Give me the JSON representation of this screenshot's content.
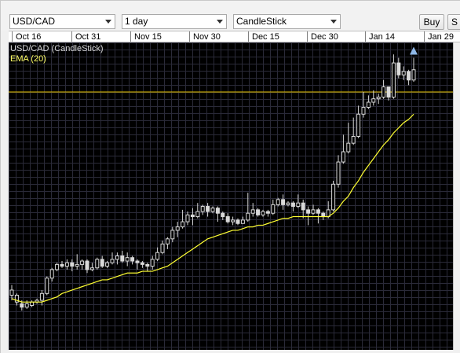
{
  "toolbar": {
    "symbol": "USD/CAD",
    "interval": "1 day",
    "chart_type": "CandleStick",
    "buy_label": "Buy",
    "sell_label": "S"
  },
  "date_axis": [
    "Oct 16",
    "Oct 31",
    "Nov 15",
    "Nov 30",
    "Dec 15",
    "Dec 30",
    "Jan 14",
    "Jan 29"
  ],
  "legend": {
    "main": "USD/CAD (CandleStick)",
    "ema": "EMA (20)"
  },
  "colors": {
    "background": "#000000",
    "grid": "#2a2a38",
    "candle": "#d9d9d9",
    "ema": "#ffff33",
    "price_line": "#e6c200",
    "arrow": "#8fb8e8"
  },
  "chart_data": {
    "type": "candlestick",
    "ylim": [
      0.965,
      1.145
    ],
    "price_line": 1.116,
    "candles": [
      [
        0.997,
        1.0,
        0.994,
        1.003
      ],
      [
        0.993,
        0.997,
        0.991,
        0.998
      ],
      [
        0.992,
        0.99,
        0.988,
        0.994
      ],
      [
        0.99,
        0.992,
        0.989,
        0.994
      ],
      [
        0.991,
        0.993,
        0.99,
        0.994
      ],
      [
        0.993,
        0.994,
        0.992,
        0.995
      ],
      [
        0.994,
        0.998,
        0.991,
        1.0
      ],
      [
        0.998,
        1.007,
        0.997,
        1.008
      ],
      [
        1.007,
        1.012,
        1.005,
        1.013
      ],
      [
        1.012,
        1.015,
        1.011,
        1.016
      ],
      [
        1.015,
        1.014,
        1.013,
        1.017
      ],
      [
        1.014,
        1.016,
        1.012,
        1.018
      ],
      [
        1.016,
        1.014,
        1.011,
        1.018
      ],
      [
        1.014,
        1.015,
        1.012,
        1.021
      ],
      [
        1.015,
        1.017,
        1.012,
        1.018
      ],
      [
        1.017,
        1.012,
        1.01,
        1.018
      ],
      [
        1.012,
        1.013,
        1.011,
        1.016
      ],
      [
        1.013,
        1.018,
        1.012,
        1.019
      ],
      [
        1.018,
        1.014,
        1.013,
        1.02
      ],
      [
        1.014,
        1.016,
        1.013,
        1.017
      ],
      [
        1.016,
        1.018,
        1.015,
        1.022
      ],
      [
        1.018,
        1.02,
        1.015,
        1.022
      ],
      [
        1.02,
        1.017,
        1.016,
        1.023
      ],
      [
        1.017,
        1.019,
        1.014,
        1.022
      ],
      [
        1.019,
        1.017,
        1.015,
        1.02
      ],
      [
        1.017,
        1.016,
        1.012,
        1.018
      ],
      [
        1.016,
        1.015,
        1.013,
        1.017
      ],
      [
        1.015,
        1.014,
        1.011,
        1.016
      ],
      [
        1.014,
        1.018,
        1.012,
        1.02
      ],
      [
        1.018,
        1.022,
        1.017,
        1.025
      ],
      [
        1.022,
        1.027,
        1.021,
        1.029
      ],
      [
        1.027,
        1.03,
        1.024,
        1.031
      ],
      [
        1.03,
        1.035,
        1.028,
        1.037
      ],
      [
        1.035,
        1.037,
        1.031,
        1.04
      ],
      [
        1.037,
        1.04,
        1.036,
        1.047
      ],
      [
        1.04,
        1.044,
        1.038,
        1.046
      ],
      [
        1.044,
        1.043,
        1.038,
        1.048
      ],
      [
        1.043,
        1.046,
        1.042,
        1.051
      ],
      [
        1.046,
        1.049,
        1.044,
        1.05
      ],
      [
        1.049,
        1.046,
        1.043,
        1.051
      ],
      [
        1.046,
        1.048,
        1.045,
        1.049
      ],
      [
        1.048,
        1.045,
        1.04,
        1.049
      ],
      [
        1.045,
        1.043,
        1.041,
        1.046
      ],
      [
        1.043,
        1.04,
        1.039,
        1.045
      ],
      [
        1.04,
        1.041,
        1.038,
        1.043
      ],
      [
        1.041,
        1.039,
        1.038,
        1.042
      ],
      [
        1.039,
        1.041,
        1.039,
        1.043
      ],
      [
        1.041,
        1.045,
        1.04,
        1.057
      ],
      [
        1.045,
        1.047,
        1.043,
        1.051
      ],
      [
        1.047,
        1.044,
        1.043,
        1.048
      ],
      [
        1.044,
        1.046,
        1.043,
        1.047
      ],
      [
        1.046,
        1.045,
        1.043,
        1.047
      ],
      [
        1.045,
        1.05,
        1.044,
        1.053
      ],
      [
        1.05,
        1.053,
        1.049,
        1.054
      ],
      [
        1.053,
        1.05,
        1.047,
        1.056
      ],
      [
        1.05,
        1.051,
        1.049,
        1.052
      ],
      [
        1.051,
        1.049,
        1.046,
        1.052
      ],
      [
        1.049,
        1.051,
        1.048,
        1.056
      ],
      [
        1.051,
        1.047,
        1.042,
        1.053
      ],
      [
        1.047,
        1.045,
        1.038,
        1.049
      ],
      [
        1.045,
        1.047,
        1.044,
        1.05
      ],
      [
        1.047,
        1.045,
        1.039,
        1.048
      ],
      [
        1.045,
        1.043,
        1.041,
        1.046
      ],
      [
        1.043,
        1.047,
        1.042,
        1.052
      ],
      [
        1.047,
        1.062,
        1.046,
        1.064
      ],
      [
        1.062,
        1.075,
        1.06,
        1.079
      ],
      [
        1.075,
        1.081,
        1.074,
        1.091
      ],
      [
        1.081,
        1.086,
        1.08,
        1.098
      ],
      [
        1.086,
        1.09,
        1.085,
        1.101
      ],
      [
        1.09,
        1.103,
        1.089,
        1.108
      ],
      [
        1.103,
        1.107,
        1.101,
        1.116
      ],
      [
        1.107,
        1.11,
        1.106,
        1.114
      ],
      [
        1.11,
        1.112,
        1.108,
        1.117
      ],
      [
        1.112,
        1.113,
        1.109,
        1.115
      ],
      [
        1.113,
        1.119,
        1.112,
        1.123
      ],
      [
        1.119,
        1.113,
        1.111,
        1.119
      ],
      [
        1.113,
        1.133,
        1.112,
        1.138
      ],
      [
        1.133,
        1.126,
        1.124,
        1.136
      ],
      [
        1.126,
        1.128,
        1.123,
        1.131
      ],
      [
        1.128,
        1.123,
        1.12,
        1.129
      ],
      [
        1.123,
        1.129,
        1.122,
        1.136
      ]
    ],
    "ema": [
      0.995,
      0.994,
      0.993,
      0.993,
      0.993,
      0.993,
      0.993,
      0.994,
      0.995,
      0.996,
      0.998,
      0.999,
      1.0,
      1.001,
      1.002,
      1.003,
      1.004,
      1.005,
      1.006,
      1.006,
      1.007,
      1.008,
      1.009,
      1.01,
      1.01,
      1.01,
      1.011,
      1.011,
      1.011,
      1.012,
      1.013,
      1.014,
      1.016,
      1.018,
      1.02,
      1.022,
      1.024,
      1.026,
      1.028,
      1.03,
      1.031,
      1.032,
      1.033,
      1.034,
      1.035,
      1.035,
      1.036,
      1.037,
      1.037,
      1.038,
      1.038,
      1.039,
      1.04,
      1.041,
      1.042,
      1.042,
      1.043,
      1.043,
      1.043,
      1.043,
      1.043,
      1.043,
      1.043,
      1.043,
      1.045,
      1.048,
      1.052,
      1.055,
      1.06,
      1.064,
      1.069,
      1.073,
      1.077,
      1.081,
      1.085,
      1.088,
      1.092,
      1.095,
      1.098,
      1.1,
      1.103
    ],
    "date_ticks": [
      {
        "label": "Oct 16",
        "index": 0
      },
      {
        "label": "Oct 31",
        "index": 11
      },
      {
        "label": "Nov 15",
        "index": 22
      },
      {
        "label": "Nov 30",
        "index": 33
      },
      {
        "label": "Dec 15",
        "index": 44
      },
      {
        "label": "Dec 30",
        "index": 55
      },
      {
        "label": "Jan 14",
        "index": 66
      },
      {
        "label": "Jan 29",
        "index": 77
      }
    ]
  }
}
